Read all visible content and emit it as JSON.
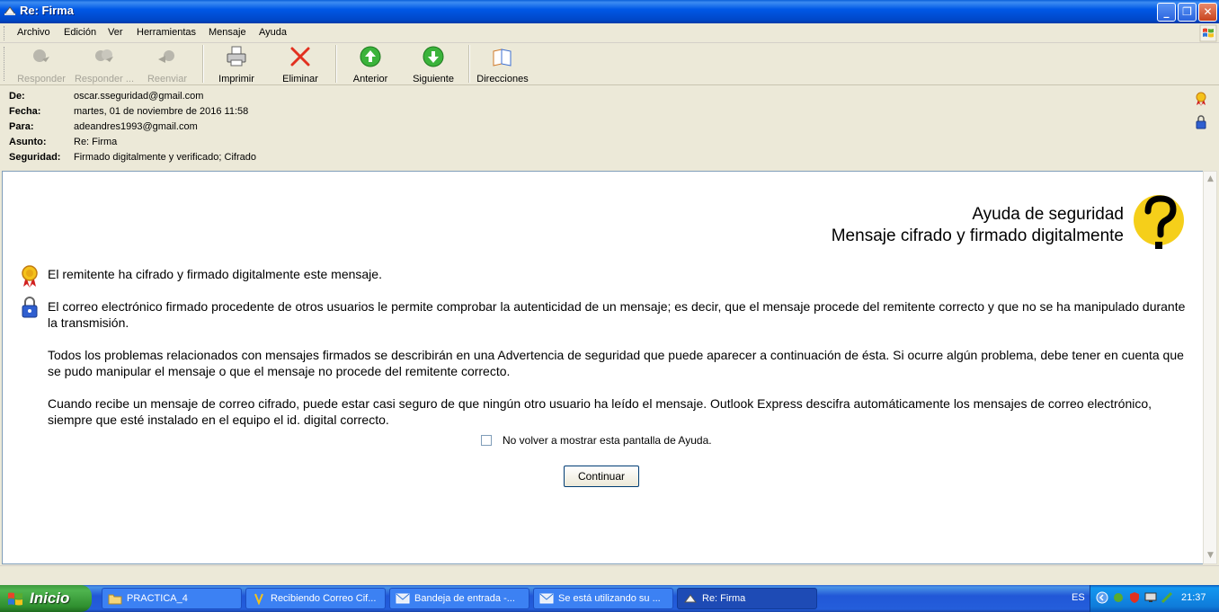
{
  "window": {
    "title": "Re: Firma"
  },
  "menu": [
    "Archivo",
    "Edición",
    "Ver",
    "Herramientas",
    "Mensaje",
    "Ayuda"
  ],
  "toolbar": {
    "reply": "Responder",
    "reply_all": "Responder ...",
    "forward": "Reenviar",
    "print": "Imprimir",
    "delete": "Eliminar",
    "previous": "Anterior",
    "next": "Siguiente",
    "addresses": "Direcciones"
  },
  "header": {
    "from_label": "De:",
    "from": "oscar.sseguridad@gmail.com",
    "date_label": "Fecha:",
    "date": "martes, 01 de noviembre de 2016 11:58",
    "to_label": "Para:",
    "to": "adeandres1993@gmail.com",
    "subject_label": "Asunto:",
    "subject": "Re: Firma",
    "security_label": "Seguridad:",
    "security": "Firmado digitalmente y verificado;  Cifrado"
  },
  "help": {
    "title1": "Ayuda de seguridad",
    "title2": "Mensaje cifrado y firmado digitalmente",
    "p1": "El remitente ha cifrado y firmado digitalmente este mensaje.",
    "p2": "El correo electrónico firmado procedente de otros usuarios le permite comprobar la autenticidad de un mensaje; es decir, que el mensaje procede del remitente correcto y que no se ha manipulado durante la transmisión.",
    "p3": "Todos los problemas relacionados con mensajes firmados se describirán en una Advertencia de seguridad que puede aparecer a continuación de ésta. Si ocurre algún problema, debe tener en cuenta que se pudo manipular el mensaje o que el mensaje no procede del remitente correcto.",
    "p4": "Cuando recibe un mensaje de correo cifrado, puede estar casi seguro de que ningún otro usuario ha leído el mensaje. Outlook Express descifra automáticamente los mensajes de correo electrónico, siempre que esté instalado en el equipo el id. digital correcto.",
    "checkbox_label": "No volver a mostrar esta pantalla de Ayuda.",
    "continue": "Continuar"
  },
  "taskbar": {
    "start": "Inicio",
    "tasks": [
      "PRACTICA_4",
      "Recibiendo Correo Cif...",
      "Bandeja de entrada -...",
      "Se está utilizando su ...",
      "Re: Firma"
    ],
    "lang": "ES",
    "clock": "21:37"
  },
  "colors": {
    "titlebar": "#0058e6",
    "taskbar": "#245edb",
    "start": "#3c9a3c"
  }
}
